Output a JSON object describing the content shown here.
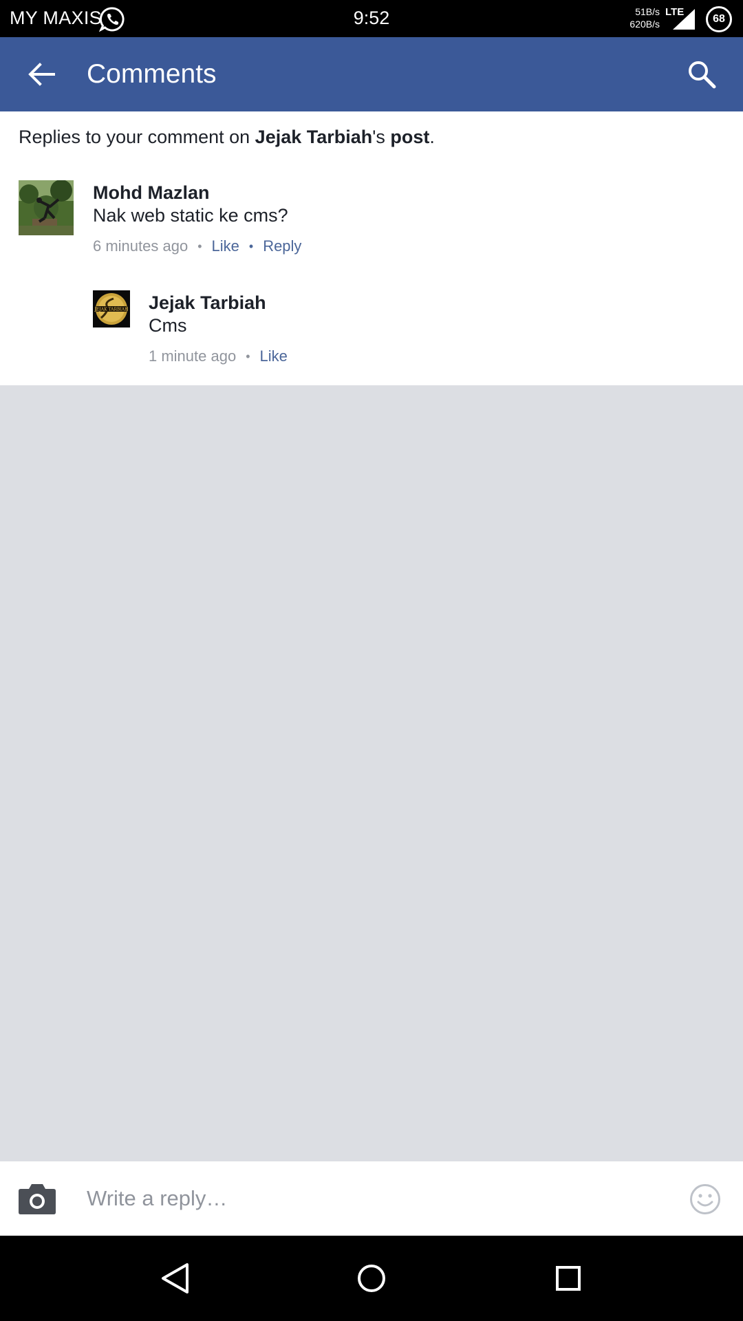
{
  "status_bar": {
    "carrier": "MY MAXIS",
    "time": "9:52",
    "upload_speed": "51B/s",
    "download_speed": "620B/s",
    "network": "LTE",
    "battery": "68"
  },
  "app_bar": {
    "title": "Comments",
    "back_icon": "arrow-back-icon",
    "search_icon": "search-icon"
  },
  "context": {
    "prefix": "Replies to your comment on ",
    "page_name": "Jejak Tarbiah",
    "possessive": "'s ",
    "post_label": "post",
    "suffix": "."
  },
  "comments": [
    {
      "author": "Mohd Mazlan",
      "text": "Nak web static ke cms?",
      "time": "6 minutes ago",
      "like_label": "Like",
      "reply_label": "Reply"
    },
    {
      "author": "Jejak Tarbiah",
      "text": "Cms",
      "time": "1 minute ago",
      "like_label": "Like",
      "avatar_logo_text": "JEJAK TARBIAH"
    }
  ],
  "composer": {
    "placeholder": "Write a reply…",
    "camera_icon": "camera-icon",
    "emoji_icon": "emoji-icon"
  },
  "nav_bar": {
    "back_icon": "nav-back-icon",
    "home_icon": "nav-home-icon",
    "recents_icon": "nav-recents-icon"
  },
  "colors": {
    "brand": "#3b5998",
    "link": "#4b6699",
    "muted": "#90949c",
    "background": "#dcdee3"
  }
}
